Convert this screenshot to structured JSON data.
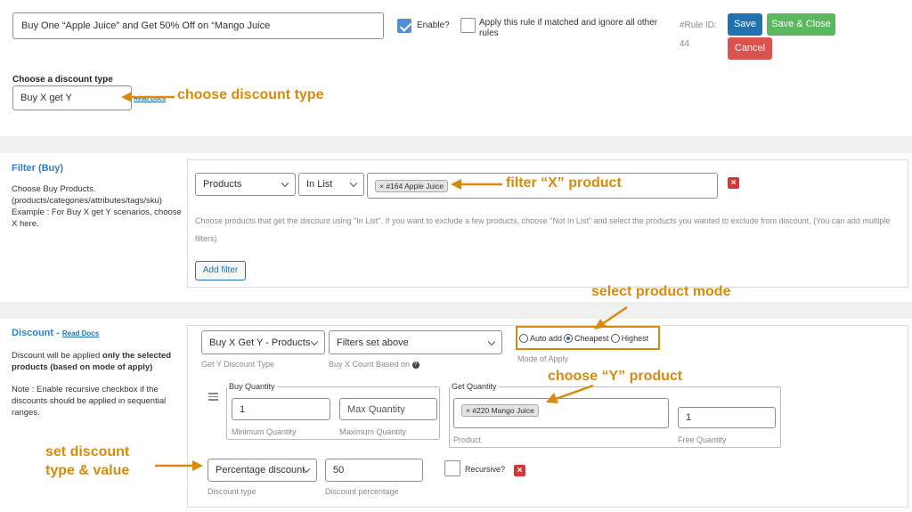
{
  "header": {
    "rule_title_value": "Buy One “Apple Juice” and Get 50% Off on “Mango Juice",
    "enable_label": "Enable?",
    "apply_rule_label": "Apply this rule if matched and ignore all other rules",
    "rule_id_label": "#Rule ID:",
    "rule_id_value": "44",
    "save_label": "Save",
    "save_close_label": "Save & Close",
    "cancel_label": "Cancel"
  },
  "discount_type": {
    "label": "Choose a discount type",
    "selected": "Buy X get Y",
    "read_docs": "Read Docs"
  },
  "filter": {
    "title": "Filter (Buy)",
    "description": "Choose Buy Products. (products/categories/attributes/tags/sku) Example : For Buy X get Y scenarios, choose X here.",
    "type_selected": "Products",
    "method_selected": "In List",
    "chip": "× #164 Apple Juice",
    "help": "Choose products that get the discount using \"In List\". If you want to exclude a few products, choose \"Not In List\" and select the products you wanted to exclude from discount. (You can add multiple filters)",
    "add_filter": "Add filter"
  },
  "discount": {
    "title": "Discount -",
    "read_docs": "Read Docs",
    "desc_prefix": "Discount will be applied ",
    "desc_bold": "only the selected products (based on mode of apply)",
    "note": "Note : Enable recursive checkbox if the discounts should be applied in sequential ranges.",
    "get_y_type_selected": "Buy X Get Y - Products",
    "get_y_type_label": "Get Y Discount Type",
    "count_based_selected": "Filters set above",
    "count_based_label": "Buy X Count Based on",
    "mode_auto_add": "Auto add",
    "mode_cheapest": "Cheapest",
    "mode_highest": "Highest",
    "mode_label": "Mode of Apply",
    "buy_quantity_legend": "Buy Quantity",
    "min_qty_value": "1",
    "min_qty_label": "Minimum Quantity",
    "max_qty_placeholder": "Max Quantity",
    "max_qty_label": "Maximum Quantity",
    "get_quantity_legend": "Get Quantity",
    "product_chip": "× #220 Mango Juice",
    "product_label": "Product",
    "free_qty_value": "1",
    "free_qty_label": "Free Quantity",
    "discount_type_selected": "Percentage discount",
    "discount_type_label": "Discount type",
    "discount_value": "50",
    "discount_value_label": "Discount percentage",
    "recursive_label": "Recursive?"
  },
  "annotations": {
    "choose_discount_type": "choose discount type",
    "filter_x": "filter “X” product",
    "select_mode": "select product mode",
    "choose_y": "choose “Y” product",
    "set_discount_line1": "set discount",
    "set_discount_line2": "type & value",
    "accent_color": "#d98a0a"
  },
  "icons": {
    "drag": "drag-handle-icon",
    "help": "question-circle-icon",
    "remove": "close-icon"
  }
}
